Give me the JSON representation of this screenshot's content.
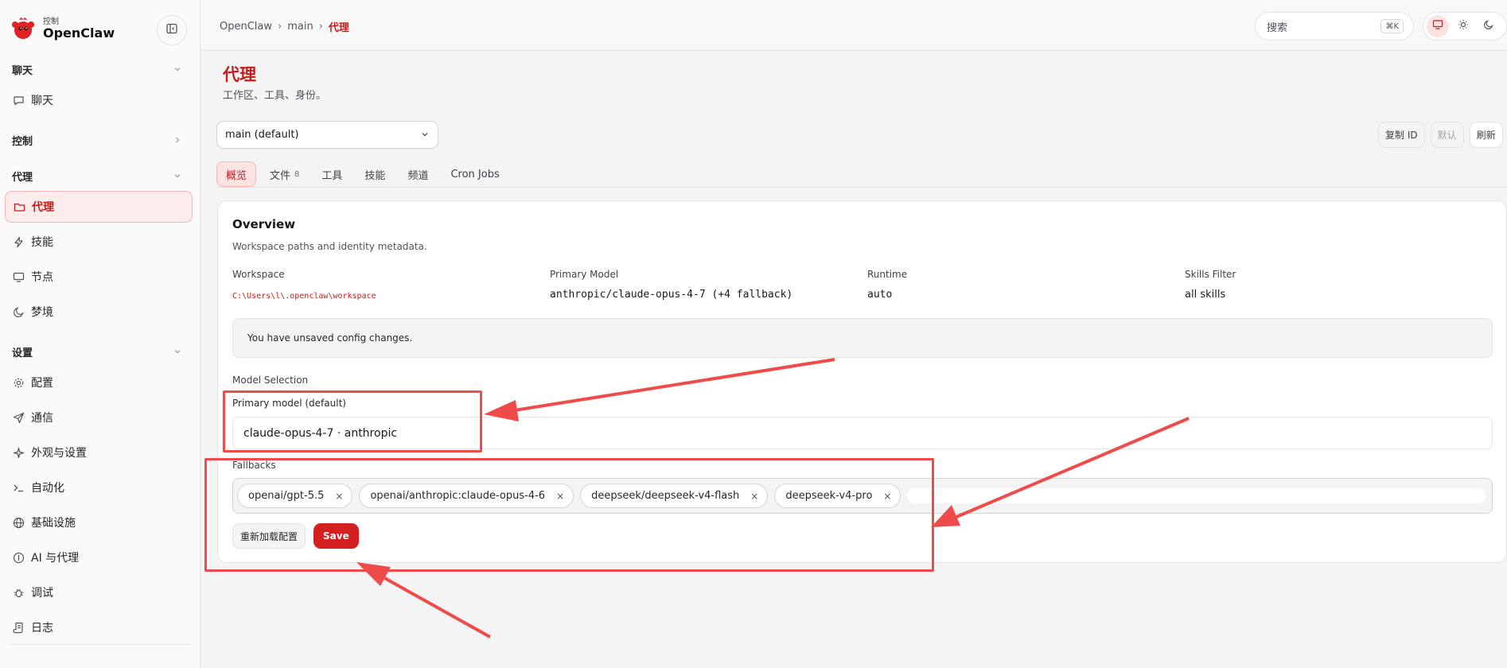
{
  "brand": {
    "sub": "控制",
    "name": "OpenClaw"
  },
  "sidebar": {
    "sections": [
      {
        "label": "聊天"
      },
      {
        "label": "控制"
      },
      {
        "label": "代理"
      },
      {
        "label": "设置"
      }
    ],
    "items": [
      {
        "label": "聊天",
        "icon": "message-icon"
      },
      {
        "label": "代理",
        "icon": "folder-icon"
      },
      {
        "label": "技能",
        "icon": "lightning-icon"
      },
      {
        "label": "节点",
        "icon": "monitor-icon"
      },
      {
        "label": "梦境",
        "icon": "moon-icon"
      },
      {
        "label": "配置",
        "icon": "gear-icon"
      },
      {
        "label": "通信",
        "icon": "send-icon"
      },
      {
        "label": "外观与设置",
        "icon": "sparkle-icon"
      },
      {
        "label": "自动化",
        "icon": "terminal-icon"
      },
      {
        "label": "基础设施",
        "icon": "globe-icon"
      },
      {
        "label": "AI 与代理",
        "icon": "ai-icon"
      },
      {
        "label": "调试",
        "icon": "bug-icon"
      },
      {
        "label": "日志",
        "icon": "scroll-icon"
      }
    ]
  },
  "breadcrumb": {
    "root": "OpenClaw",
    "mid": "main",
    "current": "代理",
    "sep": "›"
  },
  "search": {
    "placeholder": "搜索",
    "shortcut": "⌘K"
  },
  "page": {
    "title": "代理",
    "subtitle": "工作区、工具、身份。"
  },
  "agent_select": {
    "value": "main (default)"
  },
  "actions": {
    "copy_id": "复制 ID",
    "default": "默认",
    "refresh": "刷新"
  },
  "tabs": [
    {
      "label": "概览"
    },
    {
      "label": "文件",
      "count": "8"
    },
    {
      "label": "工具"
    },
    {
      "label": "技能"
    },
    {
      "label": "频道"
    },
    {
      "label": "Cron Jobs"
    }
  ],
  "overview": {
    "title": "Overview",
    "desc": "Workspace paths and identity metadata.",
    "meta": [
      {
        "label": "Workspace",
        "value": "C:\\Users\\l\\.openclaw\\workspace"
      },
      {
        "label": "Primary Model",
        "value": "anthropic/claude-opus-4-7 (+4 fallback)"
      },
      {
        "label": "Runtime",
        "value": "auto"
      },
      {
        "label": "Skills Filter",
        "value": "all skills"
      }
    ],
    "notice": "You have unsaved config changes.",
    "model_selection_label": "Model Selection",
    "primary_label": "Primary model (default)",
    "primary_value": "claude-opus-4-7 · anthropic",
    "fallbacks_label": "Fallbacks",
    "fallbacks": [
      "openai/gpt-5.5",
      "openai/anthropic:claude-opus-4-6",
      "deepseek/deepseek-v4-flash",
      "deepseek-v4-pro"
    ],
    "chip_remove": "×",
    "reload_label": "重新加载配置",
    "save_label": "Save"
  },
  "colors": {
    "accent": "#c41d1d",
    "save": "#d42020",
    "annotation": "#ef4b4b"
  }
}
